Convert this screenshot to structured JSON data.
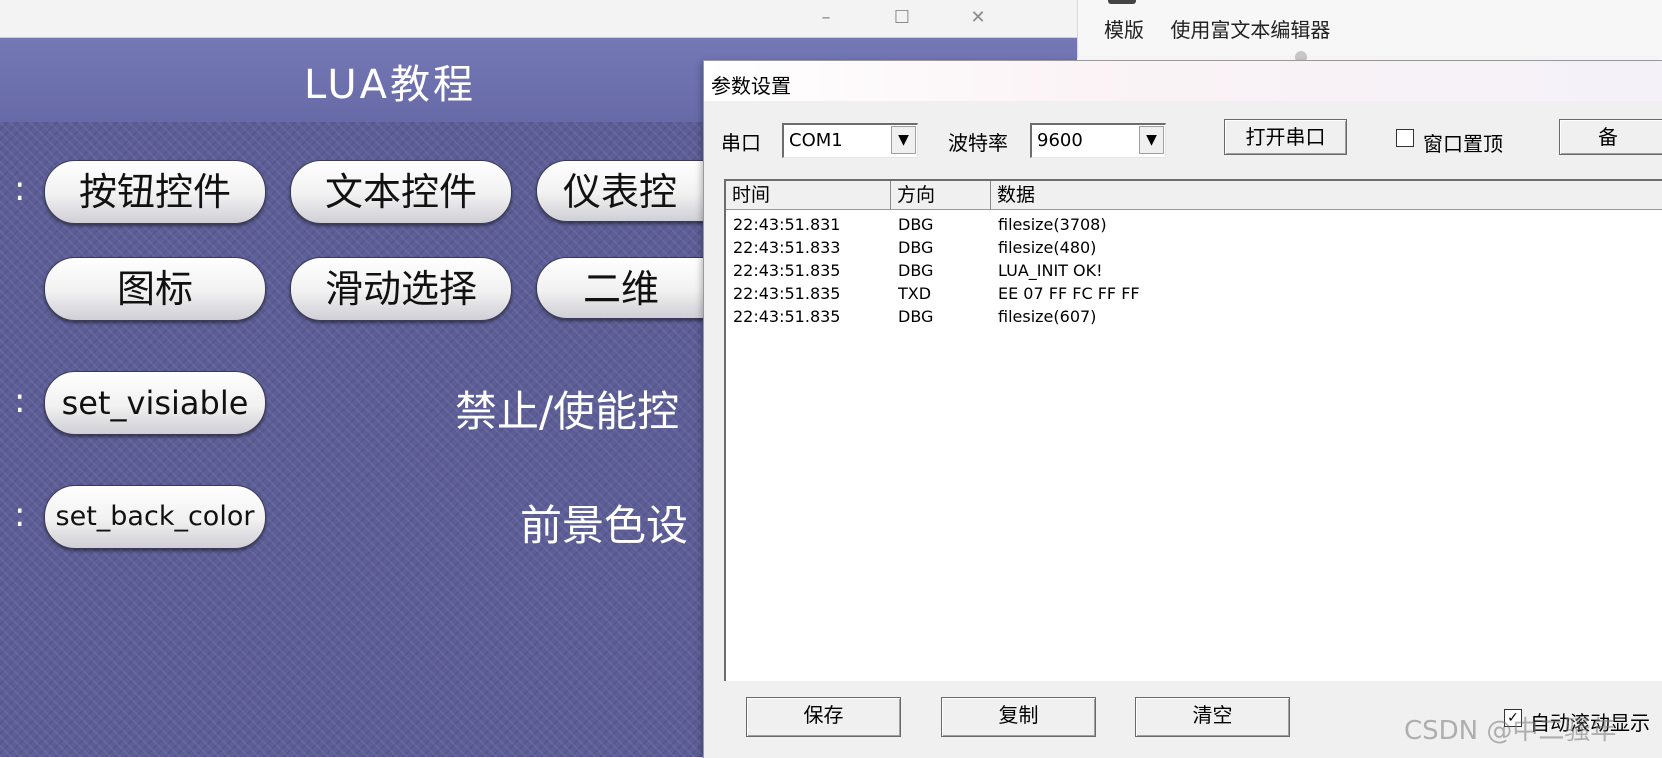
{
  "app_window": {
    "controls": {
      "minimize": "–",
      "maximize": "☐",
      "close": "✕"
    },
    "screen": {
      "title": "LUA教程",
      "row1_buttons": [
        "按钮控件",
        "文本控件",
        "仪表控"
      ],
      "row2_buttons": [
        "图标",
        "滑动选择",
        "二维"
      ],
      "colon": ":",
      "func_rows": [
        {
          "button": "set_visiable",
          "caption": "禁止/使能控"
        },
        {
          "button": "set_back_color",
          "caption": "前景色设"
        }
      ]
    }
  },
  "right_window": {
    "menu": [
      "模版",
      "使用富文本编辑器"
    ]
  },
  "dialog": {
    "title": "参数设置",
    "port_label": "串口",
    "port_value": "COM1",
    "baud_label": "波特率",
    "baud_value": "9600",
    "open_button": "打开串口",
    "topmost_label": "窗口置顶",
    "topmost_checked": false,
    "extra_button": "备",
    "columns": [
      "时间",
      "方向",
      "数据"
    ],
    "rows": [
      {
        "time": "22:43:51.831",
        "dir": "DBG",
        "data": "filesize(3708)"
      },
      {
        "time": "22:43:51.833",
        "dir": "DBG",
        "data": "filesize(480)"
      },
      {
        "time": "22:43:51.835",
        "dir": "DBG",
        "data": "LUA_INIT OK!"
      },
      {
        "time": "22:43:51.835",
        "dir": "TXD",
        "data": "EE 07 FF FC FF FF"
      },
      {
        "time": "22:43:51.835",
        "dir": "DBG",
        "data": "filesize(607)"
      }
    ],
    "bottom_buttons": [
      "保存",
      "复制",
      "清空"
    ],
    "autoscroll_label": "自动滚动显示",
    "autoscroll_checked": true
  },
  "watermark": "CSDN @中二骚年"
}
